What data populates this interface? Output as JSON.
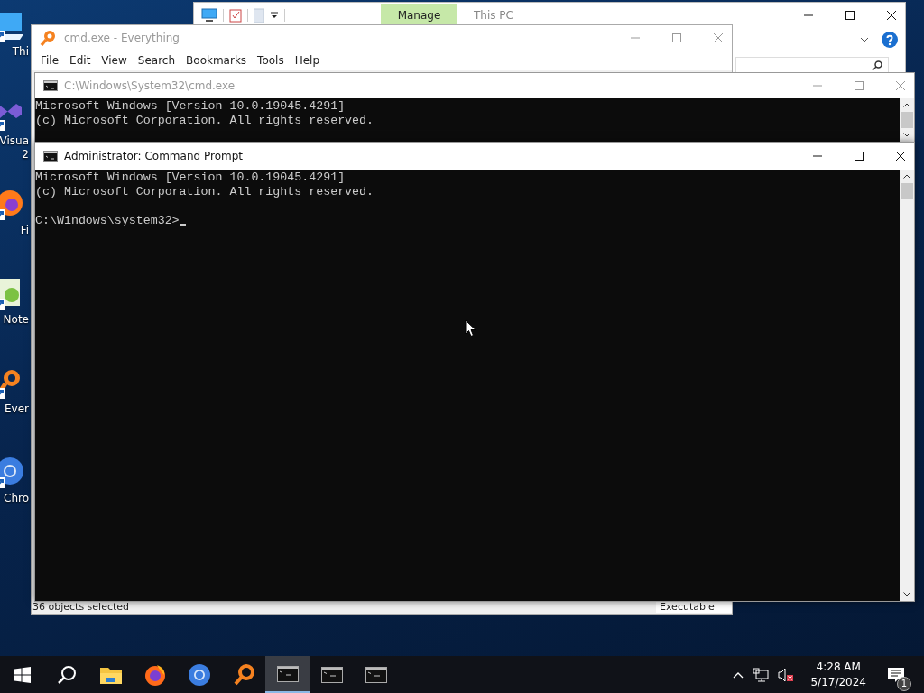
{
  "desktop_icons": [
    {
      "kind": "pc",
      "label": "Thi"
    },
    {
      "kind": "studio",
      "label": "Visua",
      "label_2": "2"
    },
    {
      "kind": "firefox",
      "label": "Fi"
    },
    {
      "kind": "notepad",
      "label": "Note"
    },
    {
      "kind": "everything",
      "label": "Ever"
    },
    {
      "kind": "chrome",
      "label": "Chro"
    }
  ],
  "explorer_window": {
    "ribbon_tab": "Manage",
    "title": "This PC"
  },
  "everything_window": {
    "title": "cmd.exe - Everything",
    "menu": [
      "File",
      "Edit",
      "View",
      "Search",
      "Bookmarks",
      "Tools",
      "Help"
    ],
    "status_left": "36 objects selected",
    "status_right": "Executable"
  },
  "console_windows": [
    {
      "title": "C:\\Windows\\System32\\cmd.exe",
      "active": false,
      "lines": [
        "Microsoft Windows [Version 10.0.19045.4291]",
        "(c) Microsoft Corporation. All rights reserved."
      ]
    },
    {
      "title": "Administrator: Command Prompt",
      "active": true,
      "lines": [
        "Microsoft Windows [Version 10.0.19045.4291]",
        "(c) Microsoft Corporation. All rights reserved."
      ],
      "prompt": "C:\\Windows\\system32>",
      "cursor": true
    }
  ],
  "taskbar": {
    "apps": [
      {
        "kind": "start",
        "selected": false
      },
      {
        "kind": "search",
        "selected": false
      },
      {
        "kind": "explorer",
        "selected": false
      },
      {
        "kind": "firefox",
        "selected": false
      },
      {
        "kind": "chrome",
        "selected": false
      },
      {
        "kind": "everything",
        "selected": false
      },
      {
        "kind": "console",
        "selected": true
      },
      {
        "kind": "console",
        "selected": false
      },
      {
        "kind": "console",
        "selected": false
      }
    ],
    "time": "4:28 AM",
    "date": "5/17/2024",
    "notification_count": "1"
  }
}
